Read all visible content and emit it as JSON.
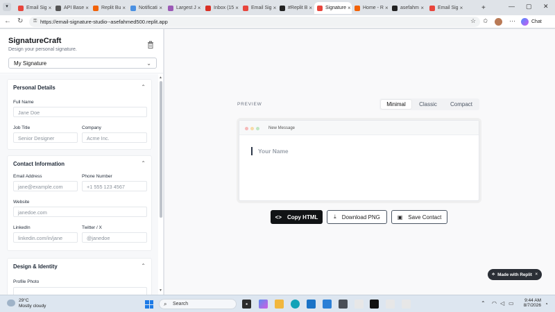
{
  "browser": {
    "tabs": [
      {
        "label": "Email Sig",
        "color": "#e8453c"
      },
      {
        "label": "API Base",
        "color": "#555555"
      },
      {
        "label": "Replit Bu",
        "color": "#f26207"
      },
      {
        "label": "Notificati",
        "color": "#4a90e2"
      },
      {
        "label": "Largest J",
        "color": "#9b59b6"
      },
      {
        "label": "Inbox (15",
        "color": "#d93025"
      },
      {
        "label": "Email Sig",
        "color": "#e8453c"
      },
      {
        "label": "#Replit B",
        "color": "#222222"
      },
      {
        "label": "Signature",
        "color": "#e8453c"
      },
      {
        "label": "Home - R",
        "color": "#f26207"
      },
      {
        "label": "asefahm",
        "color": "#222222"
      },
      {
        "label": "Email Sig",
        "color": "#e8453c"
      }
    ],
    "active_tab_index": 8,
    "new_tab": "+",
    "window_controls": {
      "minimize": "—",
      "maximize": "▢",
      "close": "✕"
    },
    "address": "https://email-signature-studio--asefahmed500.replit.app",
    "chat_label": "Chat"
  },
  "app": {
    "title": "SignatureCraft",
    "subtitle": "Design your personal signature.",
    "selected_signature": "My Signature"
  },
  "sections": {
    "personal": {
      "title": "Personal Details",
      "full_name_label": "Full Name",
      "full_name_placeholder": "Jane Doe",
      "job_title_label": "Job Title",
      "job_title_placeholder": "Senior Designer",
      "company_label": "Company",
      "company_placeholder": "Acme Inc."
    },
    "contact": {
      "title": "Contact Information",
      "email_label": "Email Address",
      "email_placeholder": "jane@example.com",
      "phone_label": "Phone Number",
      "phone_placeholder": "+1 555 123 4567",
      "website_label": "Website",
      "website_placeholder": "janedoe.com",
      "linkedin_label": "LinkedIn",
      "linkedin_placeholder": "linkedin.com/in/jane",
      "twitter_label": "Twitter / X",
      "twitter_placeholder": "@janedoe"
    },
    "design": {
      "title": "Design & Identity",
      "profile_photo_label": "Profile Photo"
    }
  },
  "preview": {
    "label": "PREVIEW",
    "styles": [
      "Minimal",
      "Classic",
      "Compact"
    ],
    "active_style": "Minimal",
    "window_title": "New Message",
    "placeholder_name": "Your Name",
    "dot_colors": [
      "#f6b9b9",
      "#f7dba8",
      "#bfe6c3"
    ]
  },
  "actions": {
    "copy_html": "Copy HTML",
    "download_png": "Download PNG",
    "save_contact": "Save Contact"
  },
  "badge": {
    "label": "Made with Replit",
    "close": "×"
  },
  "taskbar": {
    "weather_temp": "29°C",
    "weather_desc": "Mostly cloudy",
    "search_label": "Search",
    "time": "9:44 AM",
    "date": "8/7/2026"
  }
}
